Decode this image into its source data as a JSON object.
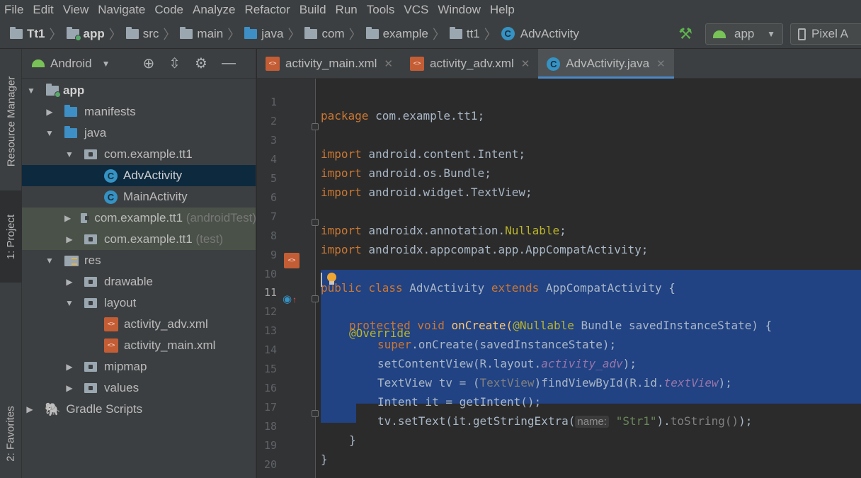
{
  "menu": [
    "File",
    "Edit",
    "View",
    "Navigate",
    "Code",
    "Analyze",
    "Refactor",
    "Build",
    "Run",
    "Tools",
    "VCS",
    "Window",
    "Help"
  ],
  "breadcrumb": [
    "Tt1",
    "app",
    "src",
    "main",
    "java",
    "com",
    "example",
    "tt1",
    "AdvActivity"
  ],
  "run_config": "app",
  "device": "Pixel A",
  "tool_tabs": {
    "resource_manager": "Resource Manager",
    "project": "1: Project",
    "favorites": "2: Favorites"
  },
  "project": {
    "view_mode": "Android",
    "tree": [
      {
        "label": "app",
        "depth": 0,
        "state": "expanded"
      },
      {
        "label": "manifests",
        "depth": 1,
        "state": "collapsed"
      },
      {
        "label": "java",
        "depth": 1,
        "state": "expanded"
      },
      {
        "label": "com.example.tt1",
        "depth": 2,
        "state": "expanded"
      },
      {
        "label": "AdvActivity",
        "depth": 3,
        "selected": true
      },
      {
        "label": "MainActivity",
        "depth": 3
      },
      {
        "label": "com.example.tt1",
        "suffix": "(androidTest)",
        "depth": 2,
        "state": "collapsed"
      },
      {
        "label": "com.example.tt1",
        "suffix": "(test)",
        "depth": 2,
        "state": "collapsed"
      },
      {
        "label": "res",
        "depth": 1,
        "state": "expanded"
      },
      {
        "label": "drawable",
        "depth": 2,
        "state": "collapsed"
      },
      {
        "label": "layout",
        "depth": 2,
        "state": "expanded"
      },
      {
        "label": "activity_adv.xml",
        "depth": 3
      },
      {
        "label": "activity_main.xml",
        "depth": 3
      },
      {
        "label": "mipmap",
        "depth": 2,
        "state": "collapsed"
      },
      {
        "label": "values",
        "depth": 2,
        "state": "collapsed"
      },
      {
        "label": "Gradle Scripts",
        "depth": 0,
        "state": "collapsed"
      }
    ]
  },
  "editor_tabs": [
    {
      "label": "activity_main.xml",
      "active": false
    },
    {
      "label": "activity_adv.xml",
      "active": false
    },
    {
      "label": "AdvActivity.java",
      "active": true
    }
  ],
  "code": {
    "line_numbers": [
      "1",
      "2",
      "3",
      "4",
      "5",
      "6",
      "7",
      "8",
      "9",
      "10",
      "11",
      "12",
      "13",
      "14",
      "15",
      "16",
      "17",
      "18",
      "19",
      "20"
    ],
    "l1": {
      "kw": "package",
      "rest": " com.example.tt1;"
    },
    "l3": {
      "kw": "import",
      "rest": " android.content.Intent;"
    },
    "l4": {
      "kw": "import",
      "rest": " android.os.Bundle;"
    },
    "l5": {
      "kw": "import",
      "rest": " android.widget.TextView;"
    },
    "l7": {
      "kw": "import",
      "rest": " androidx.annotation.",
      "ann": "Nullable",
      "end": ";"
    },
    "l8": {
      "kw": "import",
      "rest": " androidx.appcompat.app.AppCompatActivity;"
    },
    "l10": {
      "kw1": "public class",
      "name": " AdvActivity ",
      "kw2": "extends",
      "rest": " AppCompatActivity {"
    },
    "l11": {
      "ann": "@Override"
    },
    "l12": {
      "kw": "protected void",
      "m1": " onCreate(",
      "ann": "@Nullable",
      "rest": " Bundle savedInstanceState) {"
    },
    "l13": {
      "kw": "super",
      "rest": ".onCreate(savedInstanceState);"
    },
    "l14": {
      "a": "setContentView(R.layout.",
      "it": "activity_adv",
      "b": ");"
    },
    "l15": {
      "a": "TextView tv = (",
      "cast": "TextView",
      "b": ")findViewById(R.id.",
      "it": "textView",
      "c": ");"
    },
    "l16": {
      "a": "Intent it = getIntent();"
    },
    "l17": {
      "a": "tv.setText(it.getStringExtra(",
      "hint": "name:",
      "str": "\"Str1\"",
      "b": ").",
      "dim": "toString()",
      "c": ");"
    },
    "l18": {
      "a": "}"
    },
    "l19": {
      "a": "}"
    }
  },
  "colors": {
    "keyword": "#cc7832",
    "annotation": "#bbb529",
    "string": "#6a8759",
    "selection": "#214283",
    "selected_tree": "#0d293e"
  }
}
